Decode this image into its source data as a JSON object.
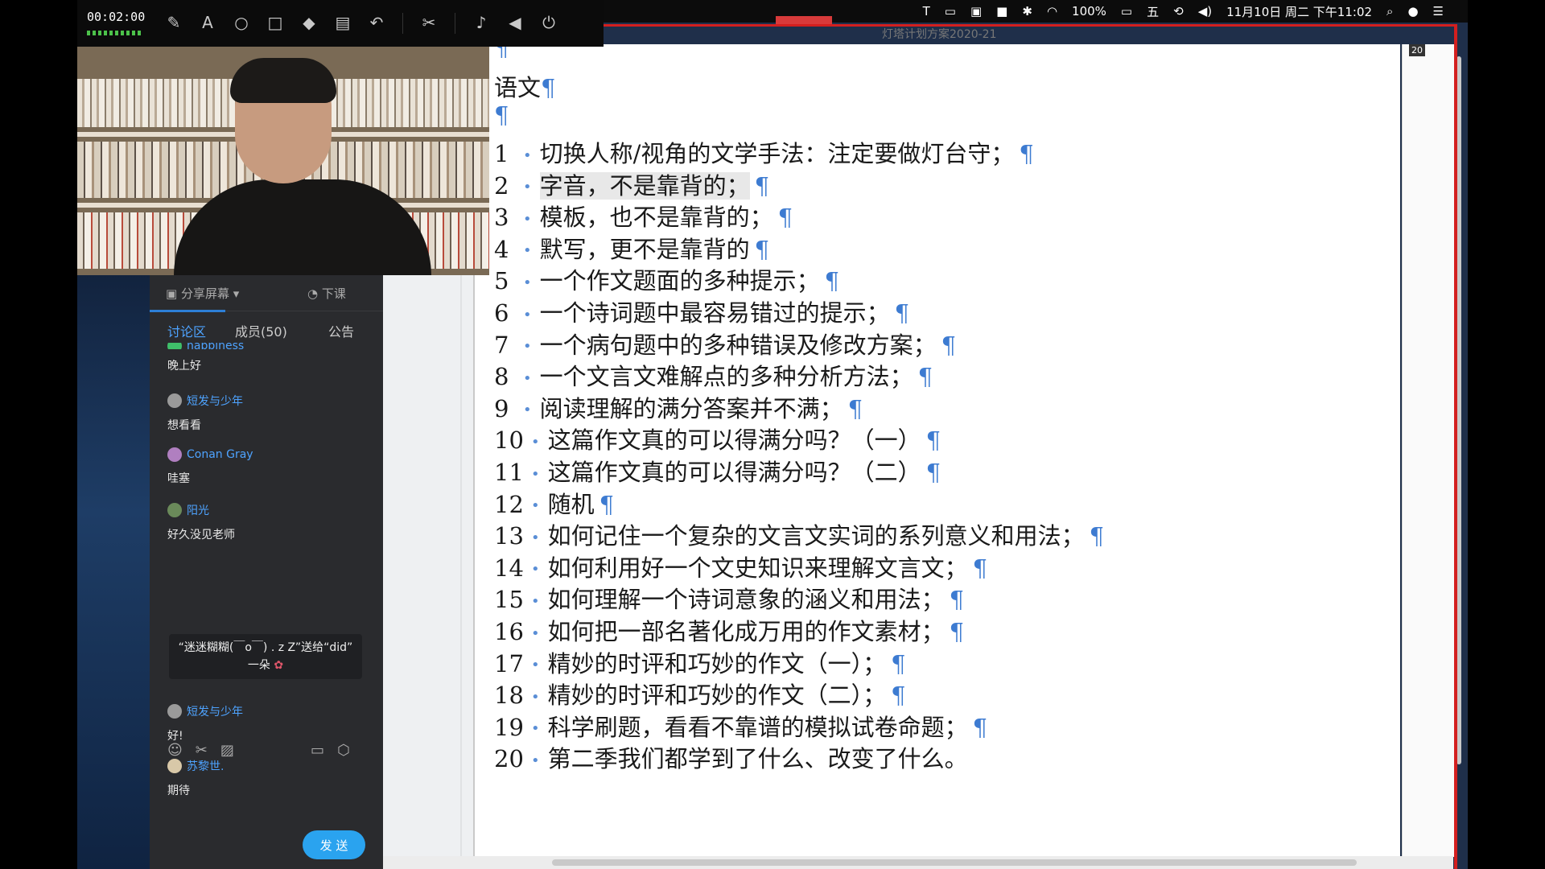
{
  "toolbar": {
    "timer": "00:02:00",
    "tools": [
      "pen-icon",
      "text-icon",
      "circle-icon",
      "rectangle-icon",
      "eraser-icon",
      "trash-icon",
      "undo-icon",
      "scissors-icon",
      "mic-icon",
      "speaker-icon",
      "power-icon"
    ]
  },
  "menubar": {
    "battery": "100%",
    "datetime": "11月10日 周二 下午11:02",
    "input_method": "五"
  },
  "doc_title": "灯塔计划方案2020-21",
  "page_number": "20",
  "panel": {
    "share_label": "分享屏幕",
    "end_label": "下课",
    "tabs": {
      "discussion": "讨论区",
      "members": "成员(50)",
      "notice": "公告"
    },
    "partial_name": "happiness",
    "messages": [
      {
        "name": "",
        "text": "晚上好"
      },
      {
        "name": "短发与少年",
        "text": "想看看"
      },
      {
        "name": "Conan Gray",
        "text": "哇塞"
      },
      {
        "name": "阳光",
        "text": "好久没见老师"
      },
      {
        "name": "短发与少年",
        "text": "好!"
      },
      {
        "name": "苏黎世.",
        "text": "期待"
      }
    ],
    "gift_text": "“迷迷糊糊(￣o￣) . z Z”送给“did”",
    "gift_line2": "一朵",
    "send_label": "发 送"
  },
  "document": {
    "heading": "语文",
    "pilcrow": "¶",
    "items": [
      {
        "num": "1",
        "text": "切换人称/视角的文学手法：注定要做灯台守；"
      },
      {
        "num": "2",
        "text": "字音，不是靠背的；"
      },
      {
        "num": "3",
        "text": "模板，也不是靠背的；"
      },
      {
        "num": "4",
        "text": "默写，更不是靠背的"
      },
      {
        "num": "5",
        "text": "一个作文题面的多种提示；"
      },
      {
        "num": "6",
        "text": "一个诗词题中最容易错过的提示；"
      },
      {
        "num": "7",
        "text": "一个病句题中的多种错误及修改方案；"
      },
      {
        "num": "8",
        "text": "一个文言文难解点的多种分析方法；"
      },
      {
        "num": "9",
        "text": "阅读理解的满分答案并不满；"
      },
      {
        "num": "10",
        "text": "这篇作文真的可以得满分吗？（一）"
      },
      {
        "num": "11",
        "text": "这篇作文真的可以得满分吗？（二）"
      },
      {
        "num": "12",
        "text": "随机"
      },
      {
        "num": "13",
        "text": "如何记住一个复杂的文言文实词的系列意义和用法；"
      },
      {
        "num": "14",
        "text": "如何利用好一个文史知识来理解文言文；"
      },
      {
        "num": "15",
        "text": "如何理解一个诗词意象的涵义和用法；"
      },
      {
        "num": "16",
        "text": "如何把一部名著化成万用的作文素材；"
      },
      {
        "num": "17",
        "text": "精妙的时评和巧妙的作文（一）；"
      },
      {
        "num": "18",
        "text": "精妙的时评和巧妙的作文（二）；"
      },
      {
        "num": "19",
        "text": "科学刷题，看看不靠谱的模拟试卷命题；"
      },
      {
        "num": "20",
        "text": "第二季我们都学到了什么、改变了什么。"
      }
    ]
  }
}
